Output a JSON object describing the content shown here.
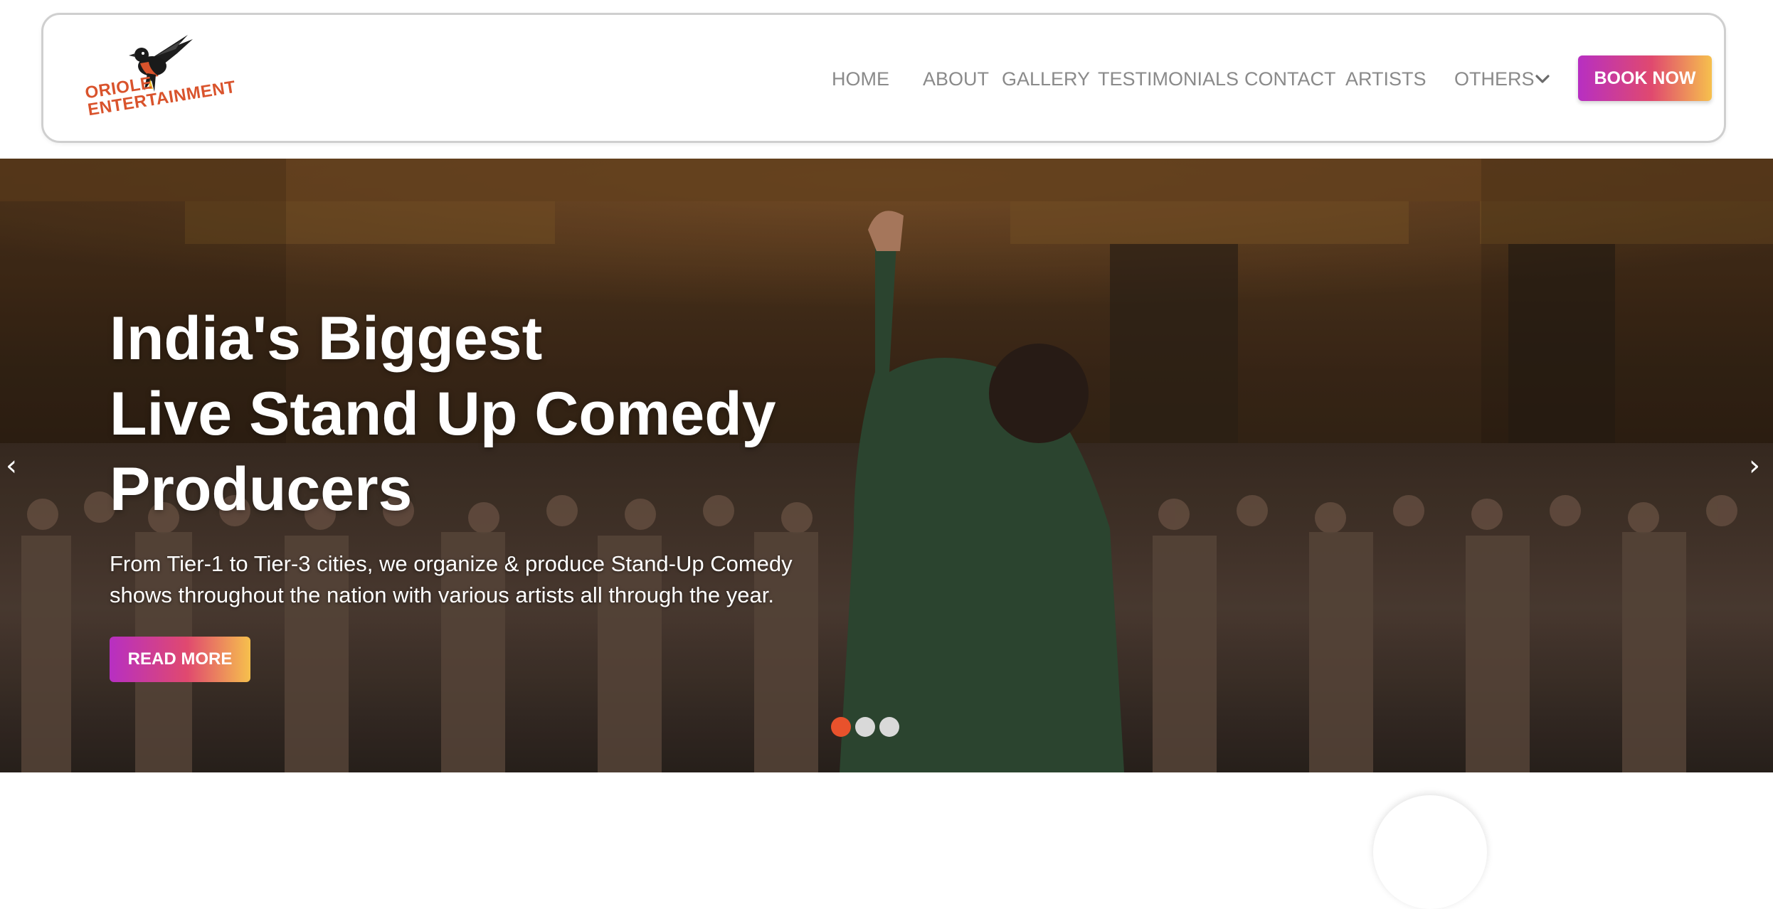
{
  "brand": {
    "logo_line1": "ORIOLE",
    "logo_line2": "ENTERTAINMENT",
    "logo_color": "#d9532c"
  },
  "nav": {
    "items": [
      {
        "label": "HOME"
      },
      {
        "label": "ABOUT"
      },
      {
        "label": "GALLERY"
      },
      {
        "label": "TESTIMONIALS"
      },
      {
        "label": "CONTACT"
      },
      {
        "label": "ARTISTS"
      },
      {
        "label": "OTHERS",
        "icon": "chevron-down-icon"
      }
    ],
    "book_label": "BOOK NOW"
  },
  "hero": {
    "title_line1": "India's Biggest",
    "title_line2": "Live Stand Up Comedy",
    "title_line3": "Producers",
    "subtitle_line1": "From Tier-1 to Tier-3 cities, we organize & produce Stand-Up Comedy",
    "subtitle_line2": "shows throughout the nation with various artists all through the year.",
    "cta_label": "READ MORE",
    "prev_arrow": "‹",
    "next_arrow": "›",
    "slides": 3,
    "active_slide": 1,
    "active_dot_color": "#e8522c"
  },
  "colors": {
    "gradient_start": "#b72fc2",
    "gradient_mid": "#e0496f",
    "gradient_end": "#f6c04d",
    "nav_text": "#8a8a8a"
  }
}
